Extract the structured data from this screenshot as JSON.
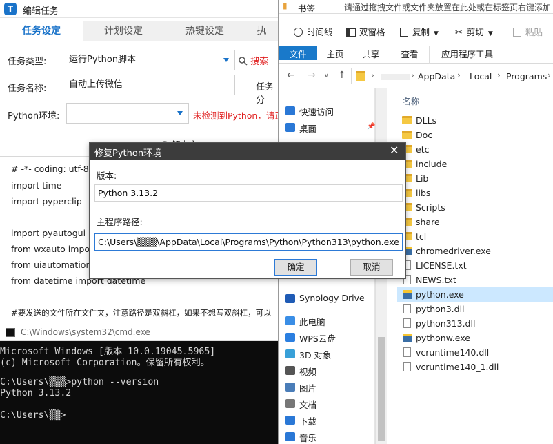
{
  "editor": {
    "title": "编辑任务",
    "logo_letter": "T",
    "tabs": [
      "任务设定",
      "计划设定",
      "热键设定",
      "执"
    ],
    "task_type_label": "任务类型:",
    "task_type_value": "运行Python脚本",
    "search_label": "搜索",
    "task_name_label": "任务名称:",
    "task_name_value": "自动上传微信",
    "task_group_label": "任务分",
    "python_env_label": "Python环境:",
    "python_env_value": "",
    "python_warning": "未检测到Python，请正",
    "partial_option": "解本文",
    "code_lines": [
      "# -*- coding: utf-8 -",
      "import time",
      "import pyperclip",
      "",
      "import pyautogui",
      "from wxauto impor",
      "from uiautomation i",
      "from datetime import datetime",
      "",
      "#要发送的文件所在文件夹，注意路径是双斜杠，如果不想写双斜杠，可以"
    ]
  },
  "cmd": {
    "title": "C:\\Windows\\system32\\cmd.exe",
    "lines": [
      "Microsoft Windows [版本 10.0.19045.5965]",
      "(c) Microsoft Corporation。保留所有权利。",
      "",
      "C:\\Users\\▒▒▒>python --version",
      "Python 3.13.2",
      "",
      "C:\\Users\\▒▒>"
    ]
  },
  "explorer": {
    "bookmarks_label": "书签",
    "bookmarks_hint": "请通过拖拽文件或文件夹放置在此处或在标签页右键添加",
    "toolbar": {
      "timeline": "时间线",
      "dual_pane": "双窗格",
      "copy": "复制",
      "cut": "剪切",
      "paste": "粘贴"
    },
    "ribbon_tabs": [
      "文件",
      "主页",
      "共享",
      "查看",
      "应用程序工具"
    ],
    "breadcrumb": [
      "AppData",
      "Local",
      "Programs"
    ],
    "column_header": "名称",
    "nav": [
      {
        "label": "快速访问",
        "icon": "star-icon",
        "color": "#2a78d6"
      },
      {
        "label": "桌面",
        "icon": "desktop-icon",
        "color": "#2a78d6"
      },
      {
        "label": "Synology Drive",
        "icon": "synology-drive-icon",
        "color": "#1f5bb5"
      },
      {
        "label": "此电脑",
        "icon": "computer-icon",
        "color": "#3a8ee6"
      },
      {
        "label": "WPS云盘",
        "icon": "cloud-icon",
        "color": "#2b7fe0"
      },
      {
        "label": "3D 对象",
        "icon": "cube-icon",
        "color": "#38a0d8"
      },
      {
        "label": "视频",
        "icon": "video-icon",
        "color": "#555555"
      },
      {
        "label": "图片",
        "icon": "picture-icon",
        "color": "#4a7db8"
      },
      {
        "label": "文档",
        "icon": "document-icon",
        "color": "#777777"
      },
      {
        "label": "下载",
        "icon": "download-icon",
        "color": "#2a78d6"
      },
      {
        "label": "音乐",
        "icon": "music-icon",
        "color": "#2a78d6"
      }
    ],
    "files": [
      {
        "name": "DLLs",
        "kind": "folder"
      },
      {
        "name": "Doc",
        "kind": "folder"
      },
      {
        "name": "etc",
        "kind": "folder"
      },
      {
        "name": "include",
        "kind": "folder"
      },
      {
        "name": "Lib",
        "kind": "folder"
      },
      {
        "name": "libs",
        "kind": "folder"
      },
      {
        "name": "Scripts",
        "kind": "folder"
      },
      {
        "name": "share",
        "kind": "folder"
      },
      {
        "name": "tcl",
        "kind": "folder"
      },
      {
        "name": "chromedriver.exe",
        "kind": "exe"
      },
      {
        "name": "LICENSE.txt",
        "kind": "doc"
      },
      {
        "name": "NEWS.txt",
        "kind": "doc"
      },
      {
        "name": "python.exe",
        "kind": "exe",
        "selected": true
      },
      {
        "name": "python3.dll",
        "kind": "doc"
      },
      {
        "name": "python313.dll",
        "kind": "doc"
      },
      {
        "name": "pythonw.exe",
        "kind": "exe"
      },
      {
        "name": "vcruntime140.dll",
        "kind": "doc"
      },
      {
        "name": "vcruntime140_1.dll",
        "kind": "doc"
      }
    ]
  },
  "dialog": {
    "title": "修复Python环境",
    "close_glyph": "✕",
    "version_label": "版本:",
    "version_value": "Python 3.13.2",
    "path_label": "主程序路径:",
    "path_value": "C:\\Users\\▒▒▒\\AppData\\Local\\Programs\\Python\\Python313\\python.exe",
    "ok_label": "确定",
    "cancel_label": "取消"
  }
}
